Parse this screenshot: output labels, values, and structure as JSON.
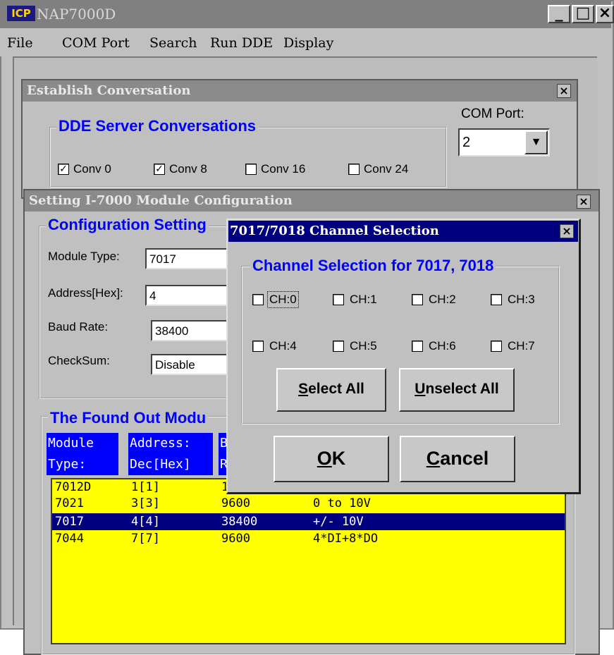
{
  "main_window": {
    "logo": "ICP",
    "title": "NAP7000D",
    "min_glyph": "_",
    "max_glyph": "□",
    "close_glyph": "×",
    "menu": [
      "File",
      "COM Port",
      "Search",
      "Run DDE",
      "Display"
    ]
  },
  "establish": {
    "title": "Establish Conversation",
    "close_glyph": "×",
    "group_label": "DDE Server Conversations",
    "conversations": [
      {
        "label": "Conv 0",
        "checked": true
      },
      {
        "label": "Conv 8",
        "checked": true
      },
      {
        "label": "Conv 16",
        "checked": false
      },
      {
        "label": "Conv 24",
        "checked": false
      }
    ],
    "com_port_label": "COM Port:",
    "com_port_value": "2"
  },
  "setting": {
    "title": "Setting I-7000 Module Configuration",
    "close_glyph": "×",
    "group_label": "Configuration Setting",
    "fields": [
      {
        "label": "Module Type:",
        "value": "7017"
      },
      {
        "label": "Address[Hex]:",
        "value": "4"
      },
      {
        "label": "Baud Rate:",
        "value": "38400"
      },
      {
        "label": "CheckSum:",
        "value": "Disable"
      }
    ],
    "found_label": "The Found Out Modu",
    "headers": [
      {
        "line1": "Module",
        "line2": "Type:"
      },
      {
        "line1": "Address:",
        "line2": "Dec[Hex]"
      },
      {
        "line1": "B",
        "line2": "R"
      }
    ],
    "rows": [
      {
        "type": "7012D",
        "addr": "1[1]",
        "baud": "1",
        "desc": "",
        "selected": false
      },
      {
        "type": "7021",
        "addr": "3[3]",
        "baud": "9600",
        "desc": "0 to 10V",
        "selected": false
      },
      {
        "type": "7017",
        "addr": "4[4]",
        "baud": "38400",
        "desc": "+/- 10V",
        "selected": true
      },
      {
        "type": "7044",
        "addr": "7[7]",
        "baud": "9600",
        "desc": "4*DI+8*DO",
        "selected": false
      }
    ]
  },
  "channel_dialog": {
    "title": "7017/7018 Channel Selection",
    "close_glyph": "×",
    "group_label": "Channel Selection for 7017, 7018",
    "channels": [
      "CH:0",
      "CH:1",
      "CH:2",
      "CH:3",
      "CH:4",
      "CH:5",
      "CH:6",
      "CH:7"
    ],
    "select_all": {
      "mnemonic": "S",
      "rest": "elect All"
    },
    "unselect_all": {
      "mnemonic": "U",
      "rest": "nselect All"
    },
    "ok": {
      "mnemonic": "O",
      "rest": "K"
    },
    "cancel": {
      "mnemonic": "C",
      "rest": "ancel"
    },
    "dropdown_glyph": "▼",
    "colors": {
      "title_bar": "#000080",
      "accent_text": "#0000ff",
      "list_bg": "#ffff00",
      "selection": "#000080"
    }
  }
}
